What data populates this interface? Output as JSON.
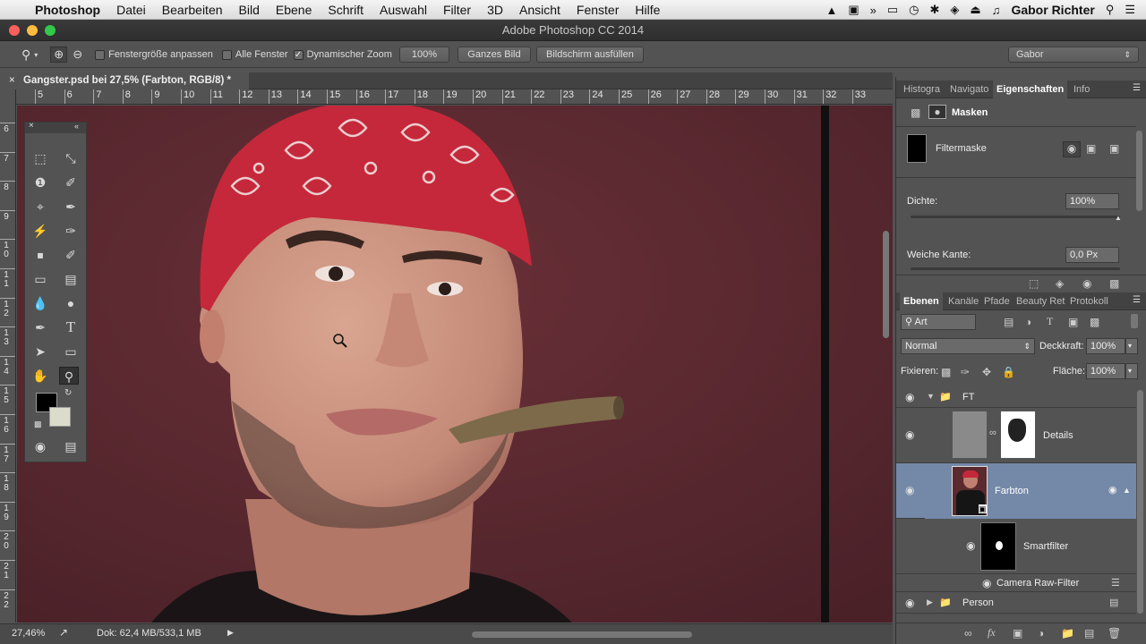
{
  "menubar": {
    "app": "Photoshop",
    "items": [
      "Datei",
      "Bearbeiten",
      "Bild",
      "Ebene",
      "Schrift",
      "Auswahl",
      "Filter",
      "3D",
      "Ansicht",
      "Fenster",
      "Hilfe"
    ],
    "user": "Gabor Richter"
  },
  "window": {
    "title": "Adobe Photoshop CC 2014"
  },
  "options": {
    "fit_window_label": "Fenstergröße anpassen",
    "all_windows_label": "Alle Fenster",
    "scrubby_zoom_label": "Dynamischer Zoom",
    "zoom_100_label": "100%",
    "fit_screen_label": "Ganzes Bild",
    "fill_screen_label": "Bildschirm ausfüllen",
    "workspace": "Gabor"
  },
  "document": {
    "tab_title": "Gangster.psd bei 27,5% (Farbton, RGB/8) *",
    "h_ruler": [
      "5",
      "6",
      "7",
      "8",
      "9",
      "10",
      "11",
      "12",
      "13",
      "14",
      "15",
      "16",
      "17",
      "18",
      "19",
      "20",
      "21",
      "22",
      "23",
      "24",
      "25",
      "26",
      "27",
      "28",
      "29",
      "30",
      "31",
      "32",
      "33"
    ],
    "v_ruler": [
      "6",
      "7",
      "8",
      "9",
      "10",
      "11",
      "12",
      "13",
      "14",
      "15",
      "16",
      "17",
      "18",
      "19",
      "20",
      "21",
      "22"
    ]
  },
  "status": {
    "zoom": "27,46%",
    "doc_size": "Dok: 62,4 MB/533,1 MB"
  },
  "properties_panel": {
    "tabs": [
      "Histogra",
      "Navigato",
      "Eigenschaften",
      "Info"
    ],
    "header": "Masken",
    "mask_type": "Filtermaske",
    "density_label": "Dichte:",
    "density_value": "100%",
    "feather_label": "Weiche Kante:",
    "feather_value": "0,0 Px"
  },
  "layers_panel": {
    "tabs": [
      "Ebenen",
      "Kanäle",
      "Pfade",
      "Beauty Ret",
      "Protokoll"
    ],
    "filter_kind": "Art",
    "blend_mode": "Normal",
    "opacity_label": "Deckkraft:",
    "opacity_value": "100%",
    "lock_label": "Fixieren:",
    "fill_label": "Fläche:",
    "fill_value": "100%",
    "layers": [
      {
        "name": "FT"
      },
      {
        "name": "Details"
      },
      {
        "name": "Farbton"
      },
      {
        "name": "Smartfilter"
      },
      {
        "name": "Camera Raw-Filter"
      },
      {
        "name": "Person"
      }
    ]
  },
  "colors": {
    "foreground": "#000000",
    "background": "#dcdccc",
    "selection": "#7489a8"
  }
}
